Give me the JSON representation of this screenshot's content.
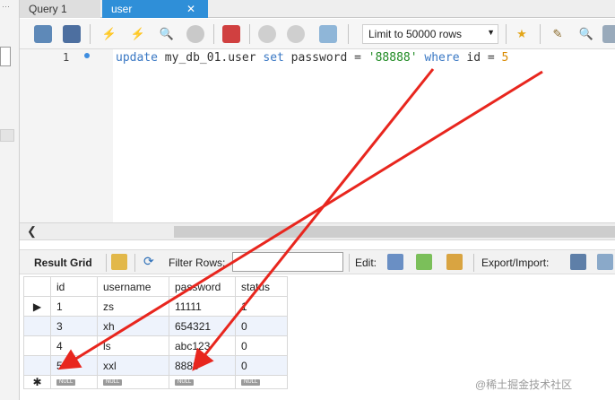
{
  "tabs": [
    {
      "label": "Query 1",
      "active": false
    },
    {
      "label": "user",
      "active": true
    }
  ],
  "toolbar": {
    "icons": [
      "open-file-icon",
      "save-icon",
      "execute-icon",
      "execute-current-icon",
      "explain-icon",
      "stop-icon",
      "toggle-results-icon",
      "commit-icon",
      "rollback-icon",
      "autocommit-icon",
      "bookmark-icon",
      "beautify-icon",
      "find-icon"
    ],
    "limit_select": "Limit to 50000 rows"
  },
  "editor": {
    "line_number": "1",
    "code": {
      "kw1": "update",
      "table": " my_db_01.user ",
      "kw2": "set",
      "col": " password = ",
      "str": "'88888'",
      "kw3": " where",
      "cond": " id = ",
      "num": "5"
    }
  },
  "results_toolbar": {
    "result_grid": "Result Grid",
    "filter_rows": "Filter Rows:",
    "filter_value": "",
    "edit": "Edit:",
    "export_import": "Export/Import:"
  },
  "grid": {
    "columns": [
      "id",
      "username",
      "password",
      "status"
    ],
    "rows": [
      [
        "1",
        "zs",
        "11111",
        "1"
      ],
      [
        "3",
        "xh",
        "654321",
        "0"
      ],
      [
        "4",
        "ls",
        "abc123",
        "0"
      ],
      [
        "5",
        "xxl",
        "8888",
        "0"
      ]
    ],
    "null_label": "NULL"
  },
  "watermark": "@稀土掘金技术社区",
  "colors": {
    "active_tab": "#2f8fd8",
    "keyword": "#3a78c4",
    "string": "#1e8a22",
    "number": "#d98a00",
    "annotation_arrow": "#e8261e"
  }
}
